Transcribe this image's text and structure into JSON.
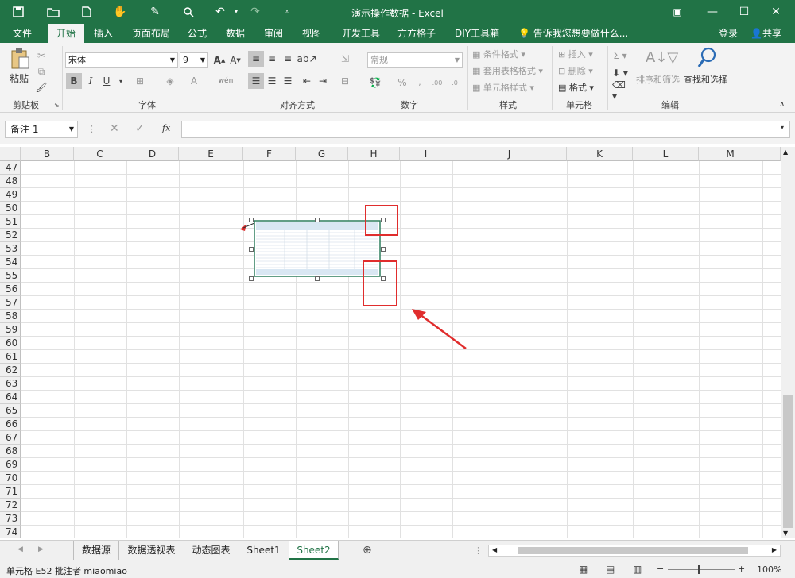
{
  "window": {
    "title": "演示操作数据 - Excel",
    "buttons": [
      "ribbon-display",
      "minimize",
      "maximize",
      "close"
    ]
  },
  "quick_access": [
    "save-icon",
    "open-icon",
    "new-icon",
    "touch-icon",
    "paint-icon",
    "print-preview-icon",
    "undo-icon",
    "redo-icon",
    "customize-icon"
  ],
  "tabs": [
    {
      "label": "文件"
    },
    {
      "label": "开始"
    },
    {
      "label": "插入"
    },
    {
      "label": "页面布局"
    },
    {
      "label": "公式"
    },
    {
      "label": "数据"
    },
    {
      "label": "审阅"
    },
    {
      "label": "视图"
    },
    {
      "label": "开发工具"
    },
    {
      "label": "方方格子"
    },
    {
      "label": "DIY工具箱"
    }
  ],
  "tellme": "告诉我您想要做什么...",
  "signin": "登录",
  "share": "共享",
  "ribbon": {
    "clipboard": {
      "paste": "粘贴",
      "group": "剪贴板"
    },
    "font": {
      "name": "宋体",
      "size": "9",
      "group": "字体",
      "bold": "B",
      "italic": "I",
      "underline": "U"
    },
    "alignment": {
      "group": "对齐方式"
    },
    "number": {
      "format": "常规",
      "group": "数字",
      "percent": "%"
    },
    "styles": {
      "conditional": "条件格式",
      "table": "套用表格格式",
      "cell_styles": "单元格样式",
      "group": "样式"
    },
    "cells": {
      "insert": "插入",
      "delete": "删除",
      "format": "格式",
      "group": "单元格"
    },
    "editing": {
      "sort": "排序和筛选",
      "find": "查找和选择",
      "group": "编辑"
    }
  },
  "formula_bar": {
    "namebox": "备注 1",
    "fx": "fx",
    "value": ""
  },
  "columns": [
    "B",
    "C",
    "D",
    "E",
    "F",
    "G",
    "H",
    "I",
    "J",
    "K",
    "L",
    "M"
  ],
  "rows": [
    "47",
    "48",
    "49",
    "50",
    "51",
    "52",
    "53",
    "54",
    "55",
    "56",
    "57",
    "58",
    "59",
    "60",
    "61",
    "62",
    "63",
    "64",
    "65",
    "66",
    "67",
    "68",
    "69",
    "70",
    "71",
    "72",
    "73",
    "74"
  ],
  "sheets": [
    {
      "label": "数据源"
    },
    {
      "label": "数据透视表"
    },
    {
      "label": "动态图表"
    },
    {
      "label": "Sheet1"
    },
    {
      "label": "Sheet2"
    }
  ],
  "active_sheet": "Sheet2",
  "status": {
    "text": "单元格 E52 批注者 miaomiao",
    "zoom": "100%"
  },
  "colors": {
    "accent": "#217346",
    "highlight": "#e02d2d"
  }
}
